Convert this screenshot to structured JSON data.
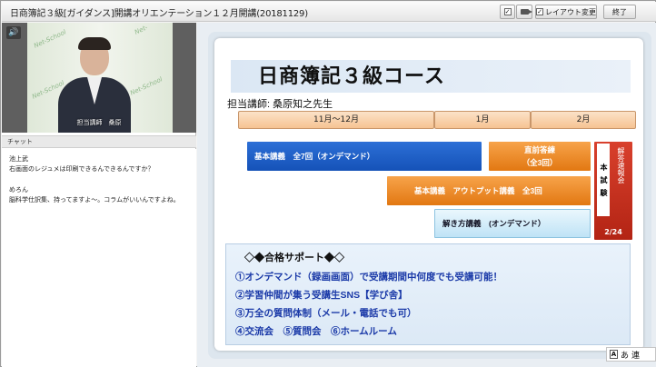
{
  "window": {
    "title": "日商簿記３級[ガイダンス]開講オリエンテーション１２月開講(20181129)",
    "layout_button": "レイアウト変更",
    "exit_button": "終了"
  },
  "video": {
    "speaker_icon": "speaker-icon",
    "caption": "担当講師　桑原",
    "watermarks": [
      "Net-School",
      "Net-",
      "Net-School",
      "Net-School"
    ]
  },
  "chat": {
    "header": "チャット",
    "messages": [
      {
        "author": "池上武",
        "text": "右画面のレジュメは印刷できるんできるんですか？"
      },
      {
        "author": "めろん",
        "text": "脳科学仕訳集、持ってますよ～。コラムがいいんですよね。"
      }
    ]
  },
  "slide": {
    "title": "日商簿記３級コース",
    "teacher": "担当講師:  桑原知之先生",
    "timeline": [
      "11月～12月",
      "1月",
      "2月"
    ],
    "bars": {
      "basic": "基本講義　全7回（オンデマンド）",
      "review": "直前答練",
      "review_sub": "（全3回）",
      "output": "基本講義　アウトプット講義　全3回",
      "solving": "解き方講義　(オンデマンド）"
    },
    "exam": {
      "label": "本試験",
      "note": "解答速報会",
      "date": "2/24"
    },
    "support": {
      "title": "◇◆合格サポート◆◇",
      "items": [
        "①オンデマンド（録画画面）で受講期間中何度でも受講可能！",
        "②学習仲間が集う受講生SNS【学び舎】",
        "③万全の質問体制（メール・電話でも可）",
        "④交流会　⑤質問会　⑥ホームルーム"
      ]
    }
  },
  "ime": {
    "mode": "あ",
    "extra": "連"
  },
  "colors": {
    "blue_bar": "#1552b8",
    "orange_bar": "#e27812",
    "exam_red": "#b32414",
    "support_text": "#1b3aa8"
  }
}
